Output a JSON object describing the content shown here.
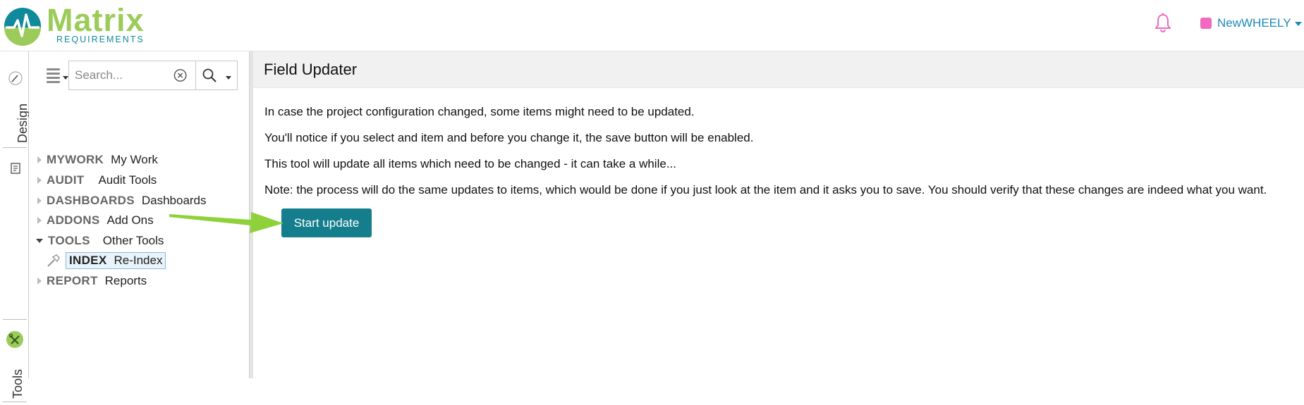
{
  "app": {
    "logo_word": "Matrix",
    "logo_sub": "REQUIREMENTS",
    "user_name": "NewWHEELY",
    "accent_color": "#147e8c",
    "logo_green": "#9ccb5a",
    "user_color": "#f06ac1"
  },
  "icons": {
    "bell": "bell-icon",
    "menu": "hamburger-icon",
    "clear": "clear-circle-icon",
    "search": "search-icon",
    "design": "brush-icon",
    "documents": "document-icon",
    "tools": "tools-icon",
    "index": "hammer-icon"
  },
  "vtabs": [
    {
      "label": "Design"
    },
    {
      "label": "Documents"
    },
    {
      "label": "Tools"
    }
  ],
  "search": {
    "placeholder": "Search..."
  },
  "tree": {
    "items": [
      {
        "key": "MYWORK",
        "label": "My Work",
        "expanded": false
      },
      {
        "key": "AUDIT",
        "label": "Audit Tools",
        "expanded": false
      },
      {
        "key": "DASHBOARDS",
        "label": "Dashboards",
        "expanded": false
      },
      {
        "key": "ADDONS",
        "label": "Add Ons",
        "expanded": false
      },
      {
        "key": "TOOLS",
        "label": "Other Tools",
        "expanded": true
      },
      {
        "key": "REPORT",
        "label": "Reports",
        "expanded": false
      }
    ],
    "child": {
      "key": "INDEX",
      "label": "Re-Index",
      "selected": true
    }
  },
  "main": {
    "title": "Field Updater",
    "paragraphs": [
      "In case the project configuration changed, some items might need to be updated.",
      "You'll notice if you select and item and before you change it, the save button will be enabled.",
      "This tool will update all items which need to be changed - it can take a while...",
      "Note: the process will do the same updates to items, which would be done if you just look at the item and it asks you to save. You should verify that these changes are indeed what you want."
    ],
    "button_label": "Start update"
  }
}
